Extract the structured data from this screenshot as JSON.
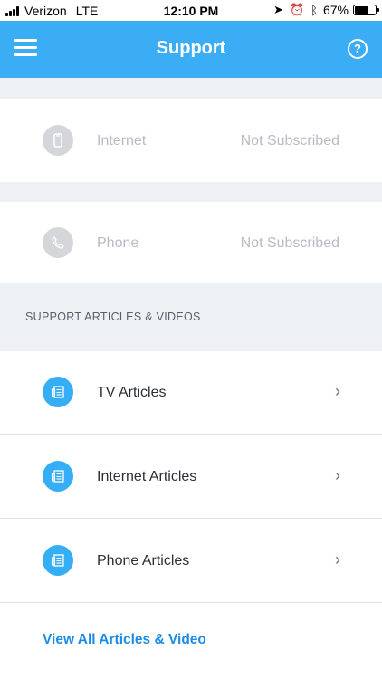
{
  "status_bar": {
    "carrier": "Verizon",
    "network": "LTE",
    "time": "12:10 PM",
    "battery_text": "67%",
    "battery_level": 0.67,
    "icons": [
      "location-arrow-icon",
      "alarm-icon",
      "bluetooth-icon",
      "battery-icon"
    ]
  },
  "nav": {
    "title": "Support",
    "menu_icon": "hamburger-icon",
    "help_icon": "?"
  },
  "services": [
    {
      "label": "Internet",
      "status": "Not Subscribed",
      "icon": "phone-handset-icon"
    },
    {
      "label": "Phone",
      "status": "Not Subscribed",
      "icon": "phone-icon"
    }
  ],
  "section": {
    "title": "SUPPORT ARTICLES & VIDEOS"
  },
  "articles": [
    {
      "label": "TV Articles",
      "icon": "article-icon"
    },
    {
      "label": "Internet Articles",
      "icon": "article-icon"
    },
    {
      "label": "Phone Articles",
      "icon": "article-icon"
    }
  ],
  "view_all": {
    "label": "View All Articles & Video"
  },
  "colors": {
    "brand_blue": "#3aadf5",
    "link_blue": "#1b8ce6",
    "muted_text": "#b7bcc2",
    "band_gray": "#eef1f4"
  }
}
